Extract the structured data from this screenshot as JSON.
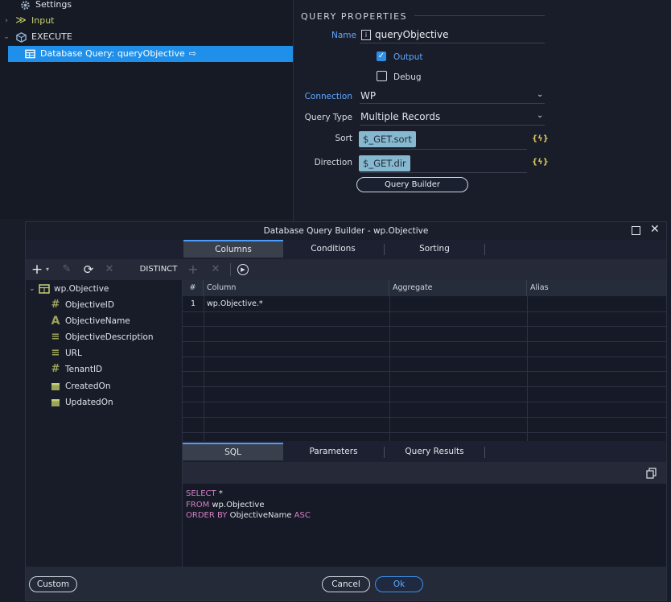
{
  "tree": {
    "items": [
      {
        "label": "Settings",
        "icon": "gear-icon"
      },
      {
        "label": "Input",
        "icon": "input-arrow-icon"
      },
      {
        "label": "EXECUTE",
        "icon": "cube-icon"
      },
      {
        "label": "Database Query: queryObjective",
        "icon": "table-icon"
      }
    ]
  },
  "props": {
    "section_title": "QUERY PROPERTIES",
    "name_label": "Name",
    "name_value": "queryObjective",
    "output_label": "Output",
    "output_checked": true,
    "debug_label": "Debug",
    "debug_checked": false,
    "connection_label": "Connection",
    "connection_value": "WP",
    "query_type_label": "Query Type",
    "query_type_value": "Multiple Records",
    "sort_label": "Sort",
    "sort_value": "$_GET.sort",
    "direction_label": "Direction",
    "direction_value": "$_GET.dir",
    "dynamic_icon_text": "{ϟ}",
    "query_builder_button": "Query Builder"
  },
  "dialog": {
    "title": "Database Query Builder - wp.Objective",
    "top_tabs": [
      "Columns",
      "Conditions",
      "Sorting"
    ],
    "active_top_tab": "Columns",
    "toolbar": {
      "distinct_label": "DISTINCT"
    },
    "table": {
      "name": "wp.Objective",
      "fields": [
        {
          "name": "ObjectiveID",
          "type": "number"
        },
        {
          "name": "ObjectiveName",
          "type": "text"
        },
        {
          "name": "ObjectiveDescription",
          "type": "longtext"
        },
        {
          "name": "URL",
          "type": "longtext"
        },
        {
          "name": "TenantID",
          "type": "number"
        },
        {
          "name": "CreatedOn",
          "type": "date"
        },
        {
          "name": "UpdatedOn",
          "type": "date"
        }
      ]
    },
    "grid": {
      "headers": [
        "#",
        "Column",
        "Aggregate",
        "Alias"
      ],
      "rows": [
        {
          "num": "1",
          "column": "wp.Objective.*",
          "aggregate": "",
          "alias": ""
        }
      ]
    },
    "bottom_tabs": [
      "SQL",
      "Parameters",
      "Query Results"
    ],
    "active_bottom_tab": "SQL",
    "sql": {
      "line1_kw": "SELECT",
      "line1_rest": " *",
      "line2_kw": "FROM",
      "line2_rest": " wp.Objective",
      "line3_kw": "ORDER BY",
      "line3_mid": " ObjectiveName ",
      "line3_kw2": "ASC"
    },
    "footer": {
      "custom_button": "Custom",
      "cancel_button": "Cancel",
      "ok_button": "Ok"
    }
  },
  "colors": {
    "accent": "#1f8fe9",
    "link_blue": "#5fa8ff",
    "chip_bg": "#86b9cf",
    "sql_keyword": "#d47fc6",
    "field_icon": "#9aa35a"
  }
}
